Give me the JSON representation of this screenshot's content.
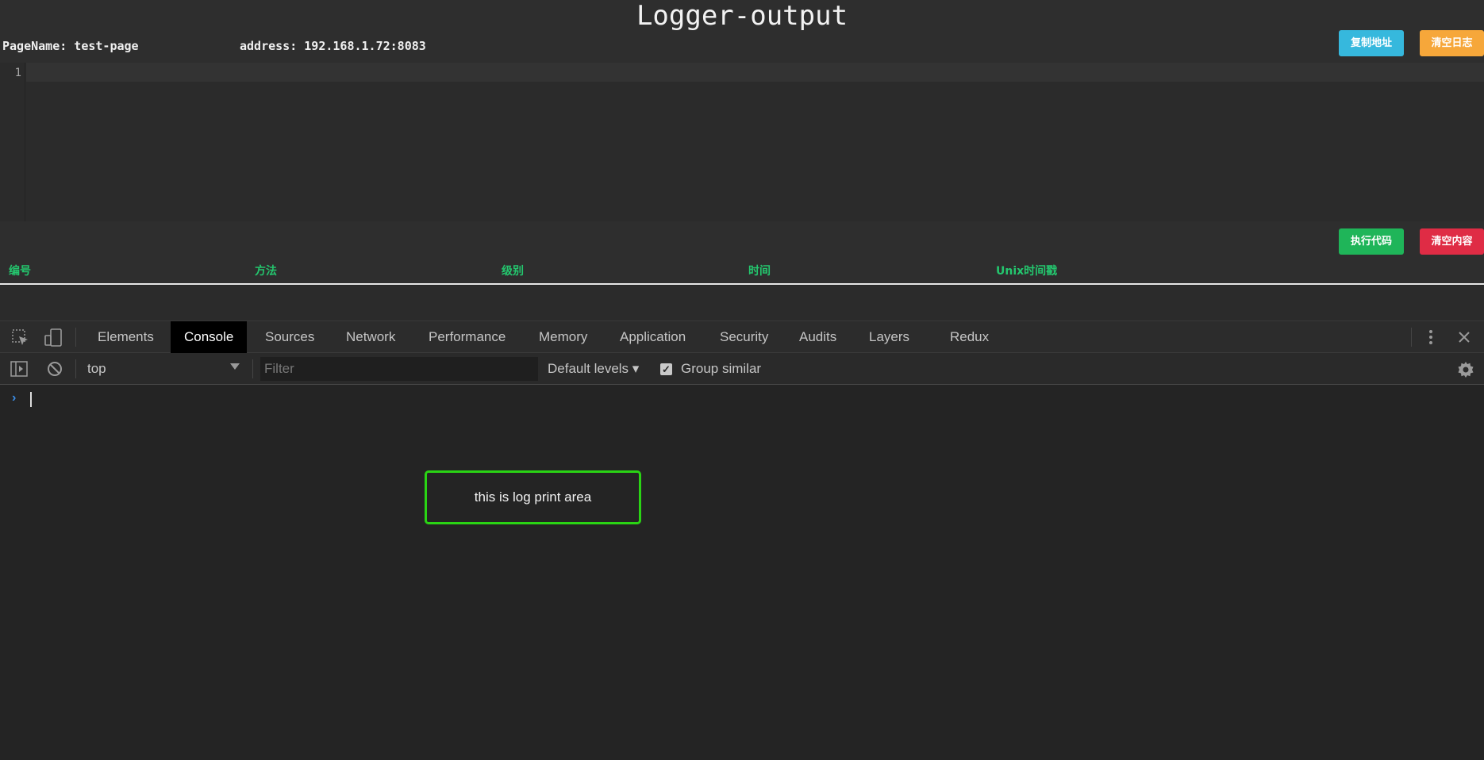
{
  "app": {
    "title": "Logger-output",
    "page_name": "PageName: test-page",
    "address": "address: 192.168.1.72:8083",
    "copy_address_button": "复制地址",
    "clear_log_button": "清空日志",
    "execute_code_button": "执行代码",
    "clear_content_button": "清空内容"
  },
  "editor": {
    "line_numbers": [
      "1"
    ]
  },
  "log_table": {
    "columns": [
      "编号",
      "方法",
      "级别",
      "时间",
      "Unix时间戳"
    ]
  },
  "devtools": {
    "tabs": [
      "Elements",
      "Console",
      "Sources",
      "Network",
      "Performance",
      "Memory",
      "Application",
      "Security",
      "Audits",
      "Layers",
      "Redux"
    ],
    "active_tab": "Console",
    "context": "top",
    "filter_placeholder": "Filter",
    "levels": "Default levels ▾",
    "group_similar": "Group similar",
    "group_similar_checked": true,
    "prompt_symbol": "›"
  },
  "annotation": {
    "text": "this is log print area",
    "border_color": "#2ad414"
  },
  "colors": {
    "copy_button": "#36b8dd",
    "clear_log_button": "#f6a73a",
    "execute_button": "#1fb559",
    "clear_content_button": "#df2c45",
    "column_header": "#24c66e"
  }
}
